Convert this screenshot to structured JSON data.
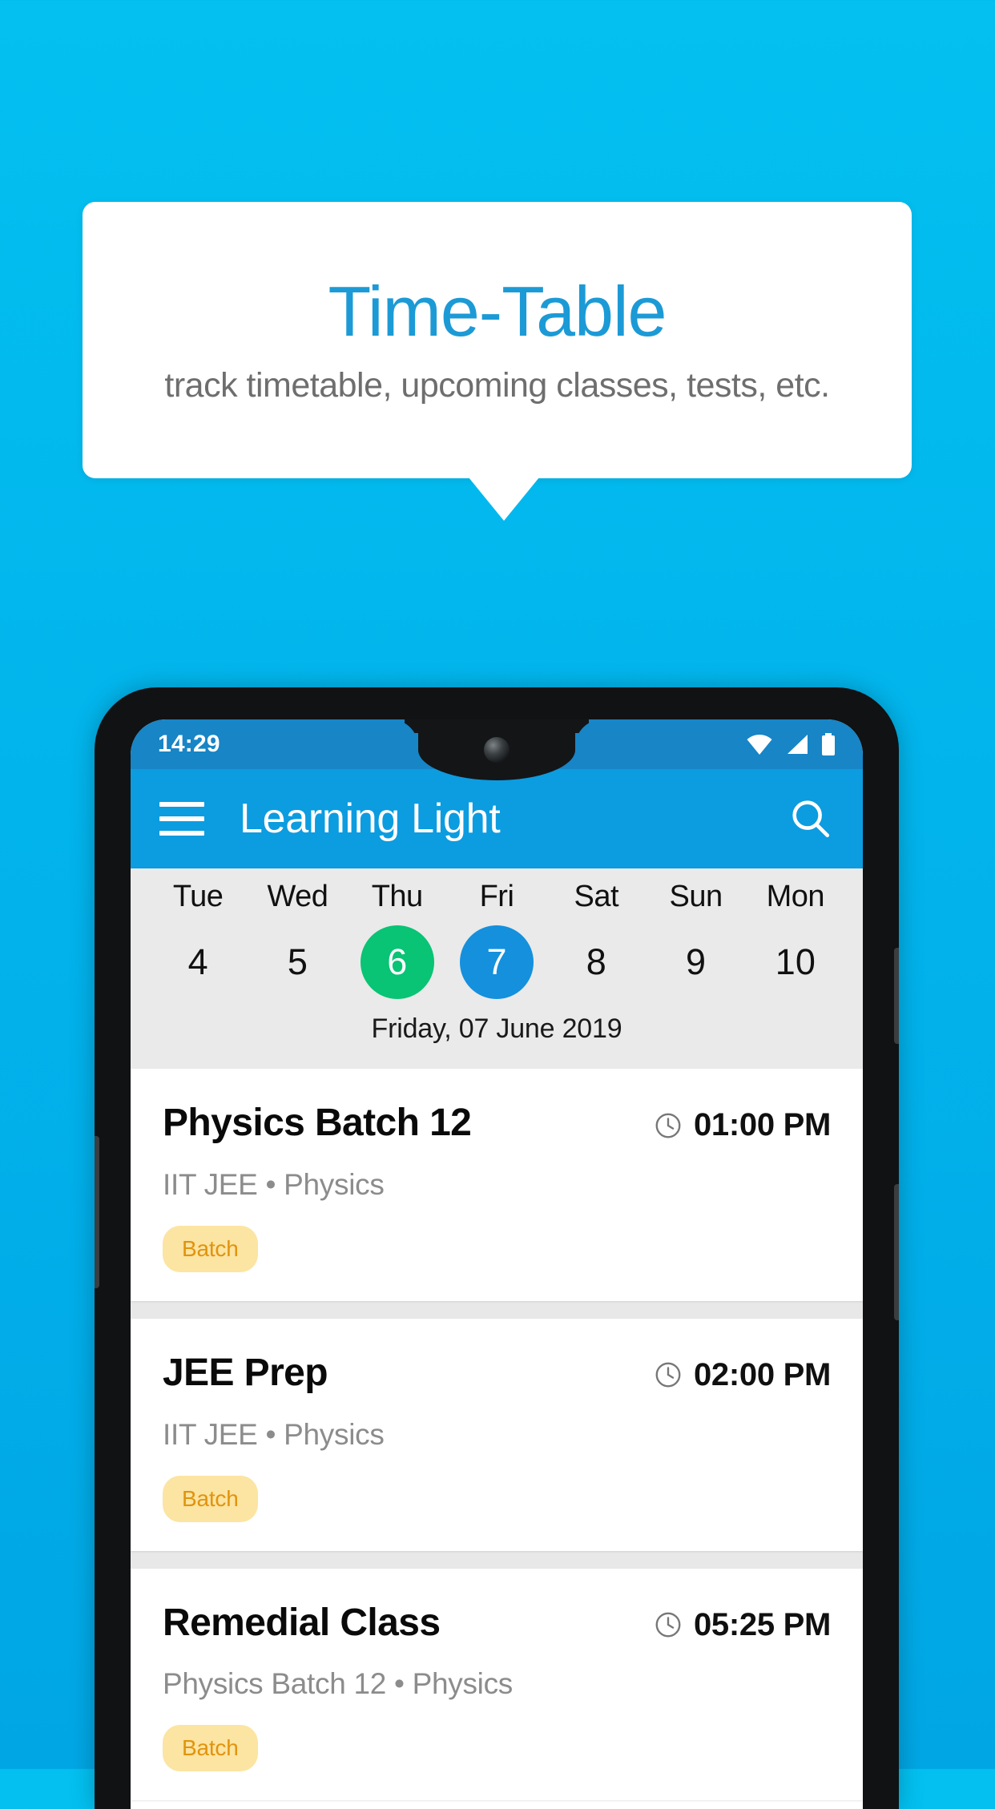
{
  "callout": {
    "title": "Time-Table",
    "subtitle": "track timetable, upcoming classes, tests, etc."
  },
  "colors": {
    "background_top": "#03C0F0",
    "background_bottom": "#00A6E4",
    "appbar": "#0C9CE0",
    "statusbar": "#1785C6",
    "title_blue": "#1C9AD6",
    "today_green": "#08C474",
    "selected_blue": "#1490DD",
    "chip_bg": "#FCE4A2",
    "chip_text": "#E0940D"
  },
  "phone": {
    "statusbar": {
      "time": "14:29",
      "icons": [
        "wifi-icon",
        "signal-icon",
        "battery-icon"
      ]
    },
    "appbar": {
      "menu_icon": "hamburger-menu-icon",
      "title": "Learning Light",
      "search_icon": "search-icon"
    },
    "daystrip": {
      "days": [
        {
          "name": "Tue",
          "num": "4",
          "state": "normal"
        },
        {
          "name": "Wed",
          "num": "5",
          "state": "normal"
        },
        {
          "name": "Thu",
          "num": "6",
          "state": "today"
        },
        {
          "name": "Fri",
          "num": "7",
          "state": "selected"
        },
        {
          "name": "Sat",
          "num": "8",
          "state": "normal"
        },
        {
          "name": "Sun",
          "num": "9",
          "state": "normal"
        },
        {
          "name": "Mon",
          "num": "10",
          "state": "normal"
        }
      ],
      "date_label": "Friday, 07 June 2019"
    },
    "classes": [
      {
        "title": "Physics Batch 12",
        "time": "01:00 PM",
        "subtitle": "IIT JEE • Physics",
        "chip": "Batch"
      },
      {
        "title": "JEE Prep",
        "time": "02:00 PM",
        "subtitle": "IIT JEE • Physics",
        "chip": "Batch"
      },
      {
        "title": "Remedial Class",
        "time": "05:25 PM",
        "subtitle": "Physics Batch 12 • Physics",
        "chip": "Batch"
      }
    ]
  }
}
